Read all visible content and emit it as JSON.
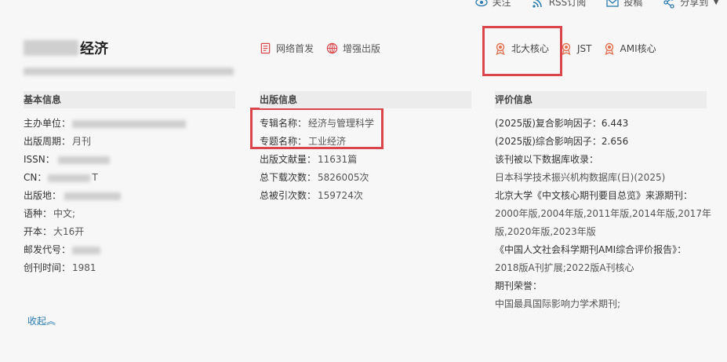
{
  "topbar": {
    "follow": "关注",
    "rss": "RSS订阅",
    "submit": "投稿",
    "share": "分享到"
  },
  "journal": {
    "title_suffix": "经济"
  },
  "pub_tags": [
    "网络首发",
    "增强出版"
  ],
  "eval_tags": [
    "北大核心",
    "JST",
    "AMI核心"
  ],
  "basic": {
    "header": "基本信息",
    "rows": [
      {
        "label": "主办单位：",
        "value": ""
      },
      {
        "label": "出版周期：",
        "value": "月刊"
      },
      {
        "label": "ISSN：",
        "value": ""
      },
      {
        "label": "CN：",
        "value": "T"
      },
      {
        "label": "出版地：",
        "value": ""
      },
      {
        "label": "语种：",
        "value": "中文;"
      },
      {
        "label": "开本：",
        "value": "大16开"
      },
      {
        "label": "邮发代号：",
        "value": ""
      },
      {
        "label": "创刊时间：",
        "value": "1981"
      }
    ]
  },
  "publish": {
    "header": "出版信息",
    "rows": [
      {
        "label": "专辑名称：",
        "value": "经济与管理科学"
      },
      {
        "label": "专题名称：",
        "value": "工业经济"
      },
      {
        "label": "出版文献量：",
        "value": "11631篇"
      },
      {
        "label": "总下载次数：",
        "value": "5826005次"
      },
      {
        "label": "总被引次数：",
        "value": "159724次"
      }
    ]
  },
  "evaluation": {
    "header": "评价信息",
    "lines": [
      "(2025版)复合影响因子：6.443",
      "(2025版)综合影响因子：2.656",
      "该刊被以下数据库收录：",
      "日本科学技术振兴机构数据库(日)(2025)",
      "北京大学《中文核心期刊要目总览》来源期刊：",
      "2000年版,2004年版,2011年版,2014年版,2017年",
      "版,2020年版,2023年版",
      "《中国人文社会科学期刊AMI综合评价报告》：",
      "2018版A刊扩展;2022版A刊核心",
      "期刊荣誉：",
      "中国最具国际影响力学术期刊;"
    ]
  },
  "collapse_label": "收起︽",
  "colors": {
    "highlight": "#d9454a",
    "icon_orange": "#e07050",
    "link": "#2a7ab0"
  }
}
